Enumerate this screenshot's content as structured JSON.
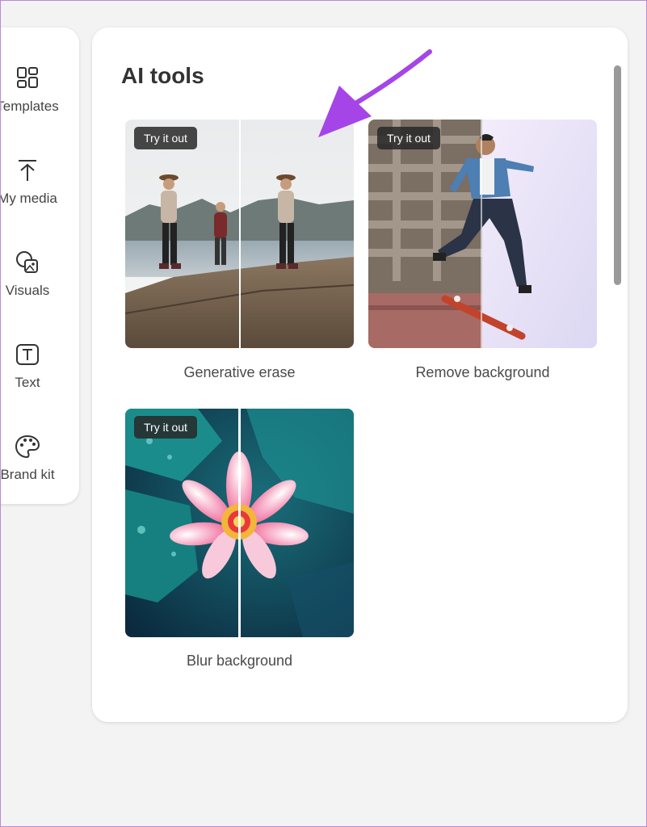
{
  "sidebar": {
    "items": [
      {
        "label": "Templates",
        "icon": "templates-icon"
      },
      {
        "label": "My media",
        "icon": "upload-icon"
      },
      {
        "label": "Visuals",
        "icon": "visuals-icon"
      },
      {
        "label": "Text",
        "icon": "text-icon"
      },
      {
        "label": "Brand kit",
        "icon": "palette-icon"
      }
    ]
  },
  "panel": {
    "title": "AI tools",
    "cards": [
      {
        "caption": "Generative erase",
        "badge": "Try it out"
      },
      {
        "caption": "Remove background",
        "badge": "Try it out"
      },
      {
        "caption": "Blur background",
        "badge": "Try it out"
      }
    ]
  },
  "colors": {
    "accent_arrow": "#a545e8",
    "badge_bg": "#2b2b2b",
    "page_bg": "#f3f3f3"
  }
}
